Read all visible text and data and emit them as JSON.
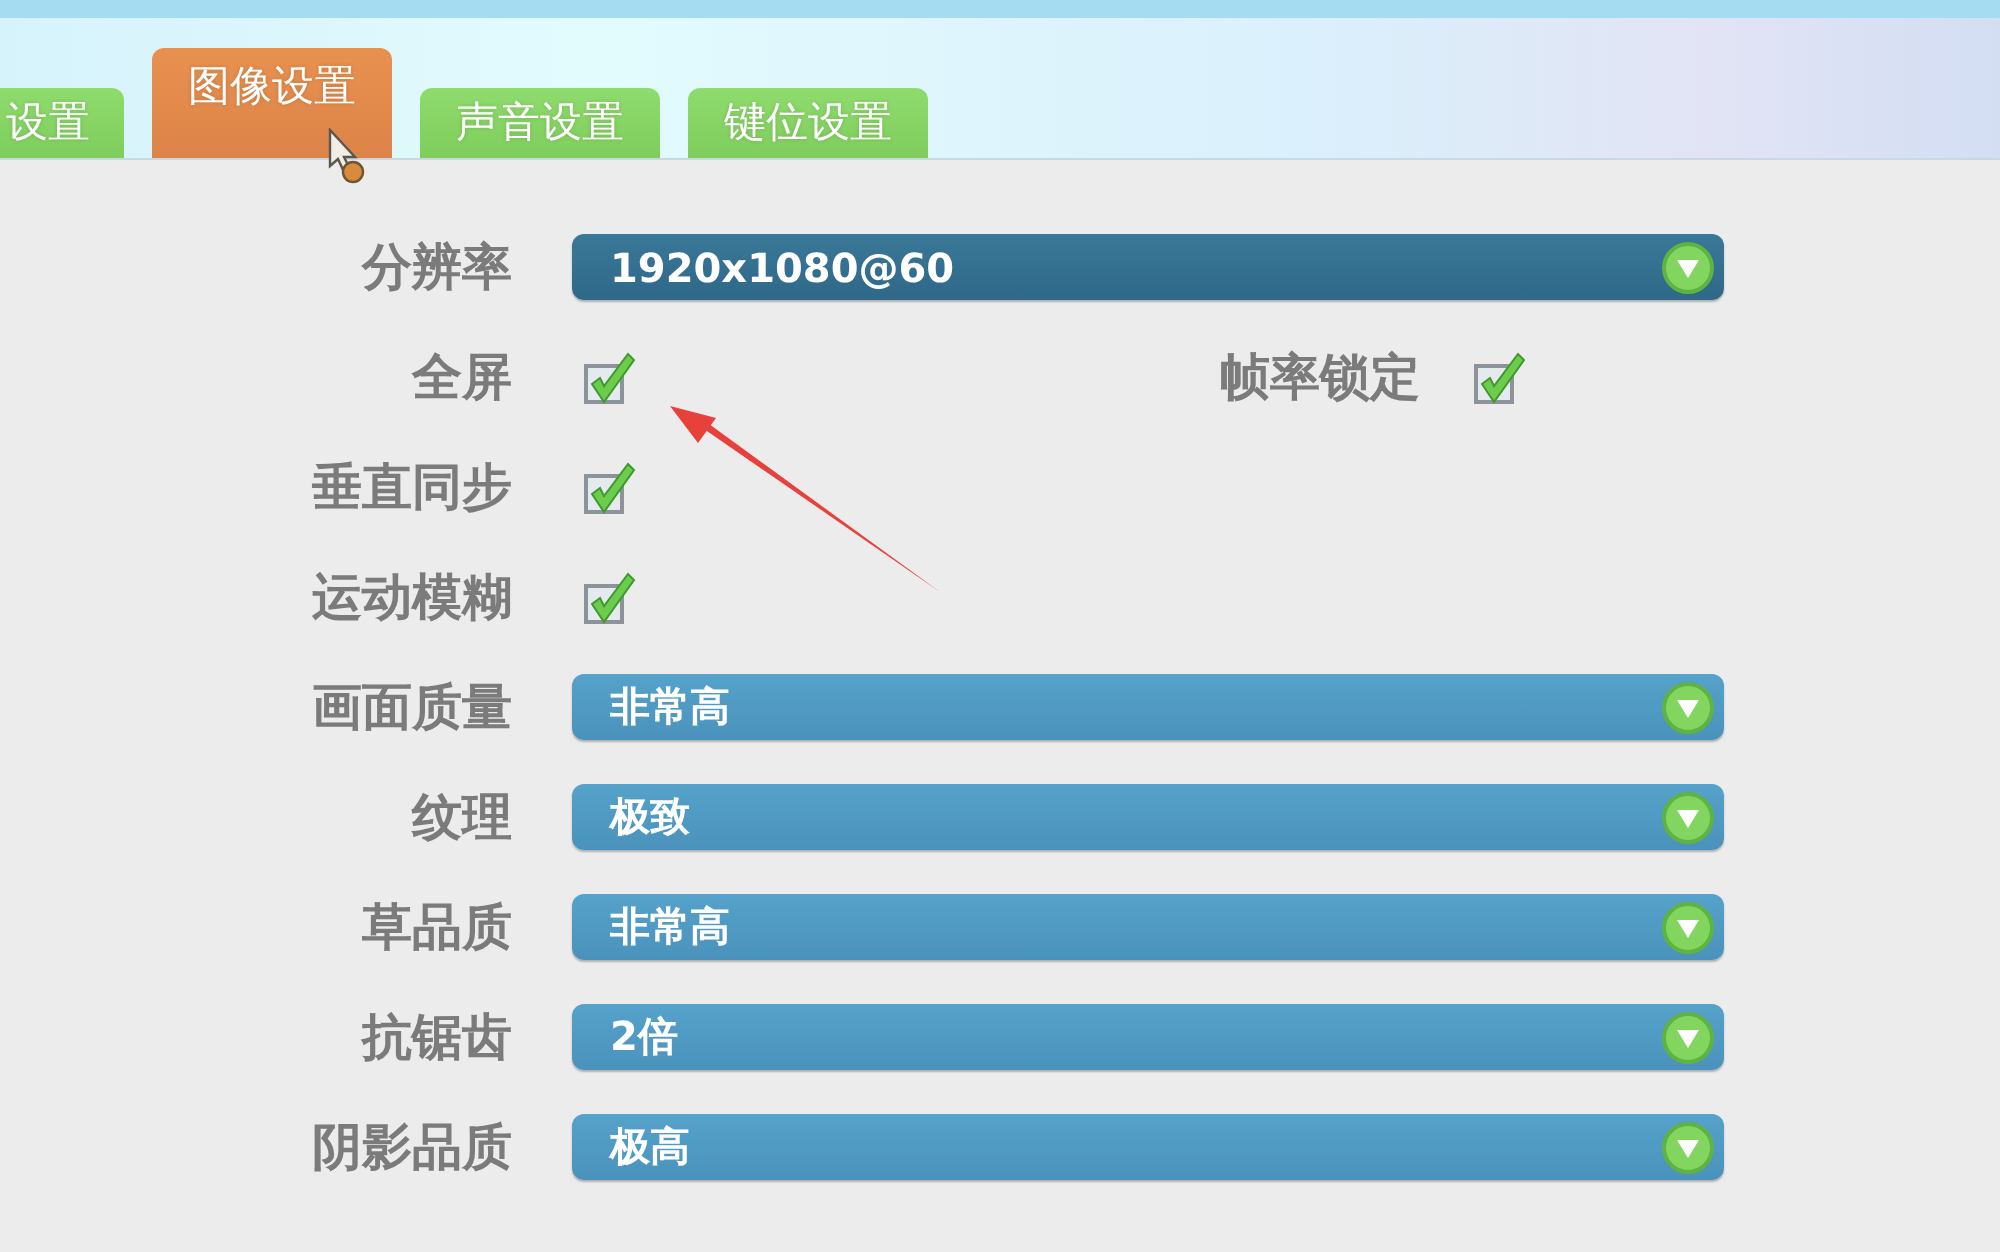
{
  "tabs": [
    {
      "label": "设置",
      "selected": false
    },
    {
      "label": "图像设置",
      "selected": true
    },
    {
      "label": "声音设置",
      "selected": false
    },
    {
      "label": "键位设置",
      "selected": false
    }
  ],
  "settings": [
    {
      "kind": "dropdown",
      "label": "分辨率",
      "value": "1920x1080@60",
      "highlighted": true
    },
    {
      "kind": "checkbox",
      "items": [
        {
          "label": "全屏",
          "checked": true
        },
        {
          "label": "帧率锁定",
          "checked": true
        }
      ]
    },
    {
      "kind": "checkbox",
      "items": [
        {
          "label": "垂直同步",
          "checked": true
        }
      ]
    },
    {
      "kind": "checkbox",
      "items": [
        {
          "label": "运动模糊",
          "checked": true
        }
      ]
    },
    {
      "kind": "dropdown",
      "label": "画面质量",
      "value": "非常高",
      "highlighted": false
    },
    {
      "kind": "dropdown",
      "label": "纹理",
      "value": "极致",
      "highlighted": false
    },
    {
      "kind": "dropdown",
      "label": "草品质",
      "value": "非常高",
      "highlighted": false
    },
    {
      "kind": "dropdown",
      "label": "抗锯齿",
      "value": "2倍",
      "highlighted": false
    },
    {
      "kind": "dropdown",
      "label": "阴影品质",
      "value": "极高",
      "highlighted": false
    }
  ]
}
